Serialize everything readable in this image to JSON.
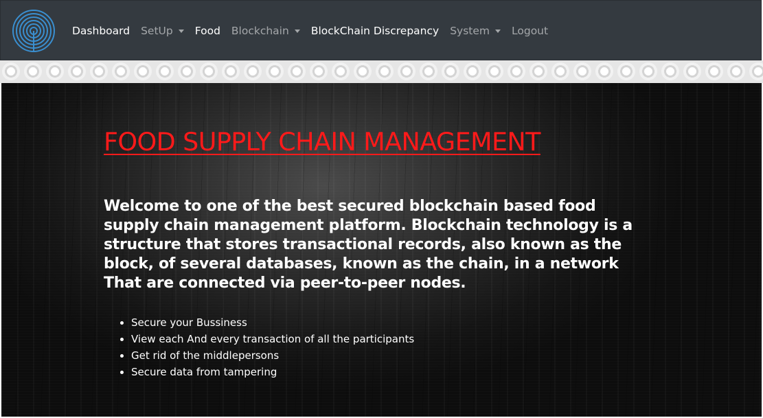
{
  "nav": {
    "items": [
      {
        "label": "Dashboard",
        "active": true,
        "dropdown": false
      },
      {
        "label": "SetUp",
        "active": false,
        "dropdown": true
      },
      {
        "label": "Food",
        "active": true,
        "dropdown": false
      },
      {
        "label": "Blockchain",
        "active": false,
        "dropdown": true
      },
      {
        "label": "BlockChain Discrepancy",
        "active": true,
        "dropdown": false
      },
      {
        "label": "System",
        "active": false,
        "dropdown": true
      },
      {
        "label": "Logout",
        "active": false,
        "dropdown": false
      }
    ]
  },
  "hero": {
    "title": "FOOD SUPPLY CHAIN MANAGEMENT",
    "intro": "Welcome to one of the best secured blockchain based food supply chain management platform. Blockchain technology is a structure that stores transactional records, also known as the block, of several databases, known as the chain, in a network That are connected via peer-to-peer nodes.",
    "features": [
      "Secure your Bussiness",
      "View each And every transaction of all the participants",
      "Get rid of the middlepersons",
      "Secure data from tampering"
    ]
  },
  "colors": {
    "navbar": "#343a40",
    "title": "#ff1a1a",
    "logo": "#3a8fd0"
  },
  "icons": {
    "logo": "wireless-signal-icon"
  }
}
